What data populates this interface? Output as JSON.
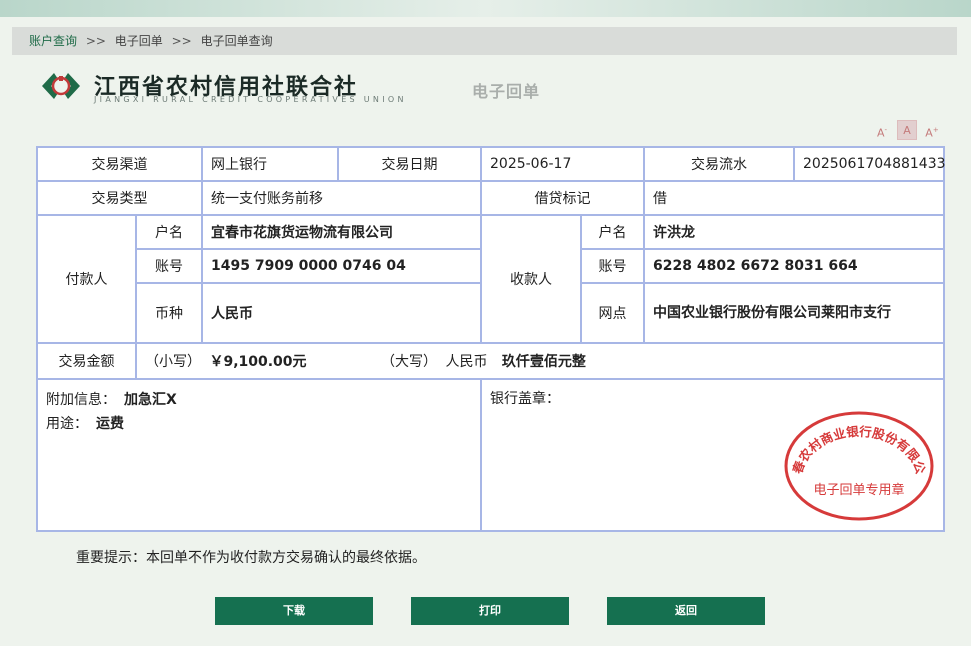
{
  "breadcrumb": {
    "items": [
      "账户查询",
      "电子回单",
      "电子回单查询"
    ],
    "separator": ">>"
  },
  "logo": {
    "name_cn": "江西省农村信用社联合社",
    "name_en": "JIANGXI RURAL CREDIT COOPERATIVES UNION"
  },
  "doc_title": "电子回单",
  "font_controls": [
    "A-",
    "A",
    "A+"
  ],
  "receipt": {
    "channel_label": "交易渠道",
    "channel_value": "网上银行",
    "date_label": "交易日期",
    "date_value": "2025-06-17",
    "serial_label": "交易流水",
    "serial_value": "2025061704881433",
    "type_label": "交易类型",
    "type_value": "统一支付账务前移",
    "dc_label": "借贷标记",
    "dc_value": "借",
    "payer": {
      "label": "付款人",
      "name_label": "户名",
      "name_value": "宜春市花旗货运物流有限公司",
      "account_label": "账号",
      "account_value": "1495 7909 0000 0746 04",
      "currency_label": "币种",
      "currency_value": "人民币"
    },
    "payee": {
      "label": "收款人",
      "name_label": "户名",
      "name_value": "许洪龙",
      "account_label": "账号",
      "account_value": "6228 4802 6672 8031 664",
      "branch_label": "网点",
      "branch_value": "中国农业银行股份有限公司莱阳市支行"
    },
    "amount": {
      "label": "交易金额",
      "small_label": "（小写）",
      "small_value": "￥9,100.00元",
      "big_label": "（大写）",
      "big_currency": "人民币",
      "big_value": "玖仟壹佰元整"
    },
    "extra_label": "附加信息：",
    "extra_value": "加急汇X",
    "purpose_label": "用途：",
    "purpose_value": "运费",
    "seal_label": "银行盖章：",
    "seal": {
      "arc_text": "宜春农村商业银行股份有限公司",
      "center_text": "电子回单专用章",
      "color": "#d63a3a"
    }
  },
  "notice": "重要提示：本回单不作为收付款方交易确认的最终依据。",
  "buttons": {
    "download": "下载",
    "print": "打印",
    "back": "返回"
  },
  "colors": {
    "brand_green": "#157050",
    "table_border": "#a7b6e6",
    "seal_red": "#d63a3a"
  }
}
